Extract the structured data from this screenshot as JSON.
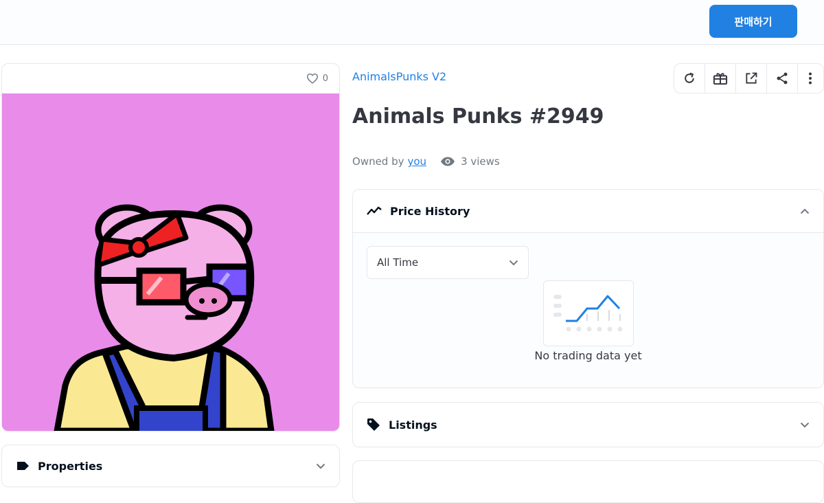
{
  "topbar": {
    "sell_label": "판매하기"
  },
  "item": {
    "favorites_count": "0",
    "collection": "AnimalsPunks V2",
    "title": "Animals Punks #2949",
    "owned_by_label": "Owned by",
    "owner": "you",
    "views": "3 views",
    "image_background": "#e98be9"
  },
  "actions": [
    "refresh-icon",
    "gift-icon",
    "external-link-icon",
    "share-icon",
    "more-icon"
  ],
  "panels": {
    "price_history": {
      "title": "Price History",
      "filter_value": "All Time",
      "empty_text": "No trading data yet"
    },
    "listings": {
      "title": "Listings"
    },
    "properties": {
      "title": "Properties"
    }
  },
  "colors": {
    "accent": "#2081e2",
    "text": "#353840",
    "muted": "#707a83",
    "border": "#e5e8eb"
  }
}
